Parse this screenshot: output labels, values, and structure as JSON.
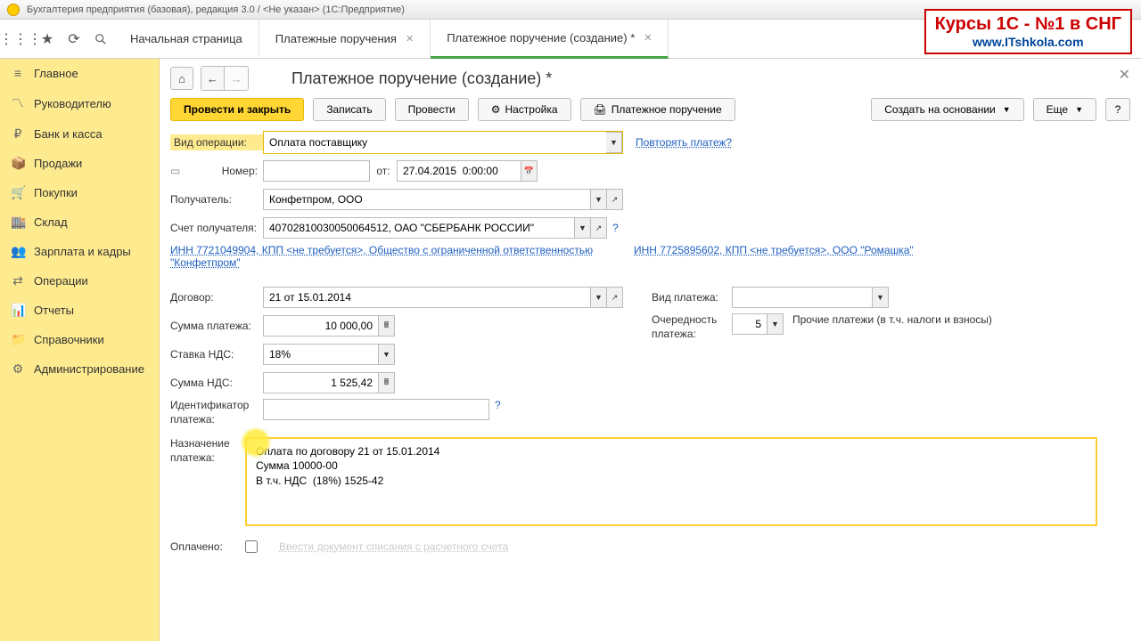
{
  "title_bar": "Бухгалтерия предприятия (базовая), редакция 3.0 / <Не указан>  (1С:Предприятие)",
  "watermark": {
    "top": "Курсы 1С - №1 в СНГ",
    "bottom": "www.ITshkola.com"
  },
  "tabs": {
    "t0": "Начальная страница",
    "t1": "Платежные поручения",
    "t2": "Платежное поручение (создание) *"
  },
  "sidebar": {
    "s0": "Главное",
    "s1": "Руководителю",
    "s2": "Банк и касса",
    "s3": "Продажи",
    "s4": "Покупки",
    "s5": "Склад",
    "s6": "Зарплата и кадры",
    "s7": "Операции",
    "s8": "Отчеты",
    "s9": "Справочники",
    "s10": "Администрирование"
  },
  "page": {
    "title": "Платежное поручение (создание) *",
    "btn_post_close": "Провести и закрыть",
    "btn_save": "Записать",
    "btn_post": "Провести",
    "btn_settings": "Настройка",
    "btn_print": "Платежное поручение",
    "btn_create_based": "Создать на основании",
    "btn_more": "Еще",
    "btn_help": "?"
  },
  "form": {
    "lbl_optype": "Вид операции:",
    "optype": "Оплата поставщику",
    "link_repeat": "Повторять платеж?",
    "lbl_num": "Номер:",
    "lbl_from": "от:",
    "date": "27.04.2015  0:00:00",
    "lbl_recipient": "Получатель:",
    "recipient": "Конфетпром, ООО",
    "lbl_account": "Счет получателя:",
    "account": "40702810030050064512, ОАО \"СБЕРБАНК РОССИИ\"",
    "link_left": "ИНН 7721049904, КПП <не требуется>, Общество с ограниченной ответственностью \"Конфетпром\"",
    "link_right": "ИНН 7725895602, КПП <не требуется>, ООО \"Ромашка\"",
    "lbl_contract": "Договор:",
    "contract": "21 от 15.01.2014",
    "lbl_paytype": "Вид платежа:",
    "lbl_sum": "Сумма платежа:",
    "sum": "10 000,00",
    "lbl_priority": "Очередность платежа:",
    "priority": "5",
    "priority_note": "Прочие платежи (в т.ч. налоги и взносы)",
    "lbl_vat_rate": "Ставка НДС:",
    "vat_rate": "18%",
    "lbl_vat_sum": "Сумма НДС:",
    "vat_sum": "1 525,42",
    "lbl_payid": "Идентификатор платежа:",
    "lbl_purpose": "Назначение платежа:",
    "purpose": "Оплата по договору 21 от 15.01.2014\nСумма 10000-00\nВ т.ч. НДС  (18%) 1525-42",
    "lbl_paid": "Оплачено:",
    "link_writeoff": "Ввести документ списания с расчетного счета"
  }
}
